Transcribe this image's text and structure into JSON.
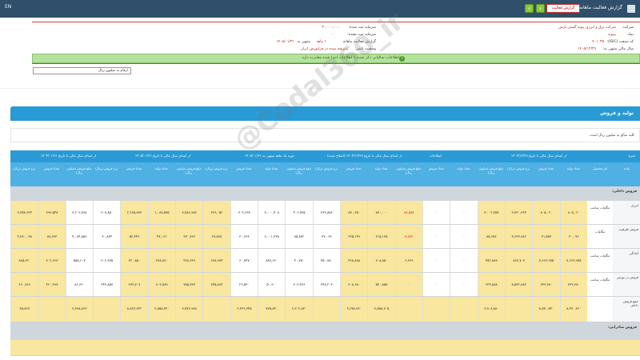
{
  "topbar": {
    "left_text": "EN",
    "title": "گزارش فعالیت ماهانه",
    "report_button": "گزارش فعالیت ماهانه",
    "nav_prev": "‹",
    "nav_next": "›"
  },
  "info": {
    "company_label": "شرکت:",
    "company_value": "شرکت برق و انرژی پیوند گستر پارس",
    "symbol_label": "نماد:",
    "symbol_value": "بپیوند",
    "code_label": "کد صنعت (ISIC):",
    "code_value": "۴۰۱۰۳۵",
    "capital_label": "سرمایه ثبت شده:",
    "capital_value": "۳۰,۰۰۰,۰۰۰",
    "unregistered_label": "سرمایه ثبت نشده:",
    "unregistered_value": "۰",
    "report_label": "گزارش فعالیت ماهانه",
    "period_label": "۱ ماهه",
    "period_end_label": "منتهی به",
    "period_end_value": "۱۴۰۵/۰۱/۳۱",
    "fiscal_label": "سال مالی منتهی به:",
    "fiscal_value": "۱۴۰۵/۱۲/۲۹",
    "status_label": "وضعیت ناشر:",
    "status_value": "پذیرفته شده در فرابورس ایران"
  },
  "notice": "اطلاعات سالیانی ذکر شده با اطلاعات ابتدا شده مغایرت دارد.",
  "select_value": "ارقام به میلیون ریال",
  "section_title": "تولید و فروش",
  "unit_note": "کلیه مبالغ به میلیون ریال است.",
  "watermark": "@Codal360_ir",
  "table": {
    "group_headers": [
      "شرح",
      "از ابتدای سال مالی تا تاریخ ۱۴۰۴/۱۲/۲۹",
      "اصلاحات",
      "از ابتدای سال مالی تا تاریخ ۱۴۰۴/۱۲/۲۹ (اصلاح شده)",
      "دوره یک ماهه منتهی به ۱۴۰۵/۰۱/۳۱",
      "از ابتدای سال مالی تا تاریخ ۱۴۰۵/۰۱/۳۱",
      "از ابتدای سال مالی تا تاریخ ۱۴۰۴/۰۱/۳۱"
    ],
    "columns": [
      "واحد",
      "نام محصول",
      "تعداد تولید",
      "تعداد فروش",
      "نرخ فروش (ریال)",
      "مبلغ فروش (میلیون ریال)",
      "تعداد تولید",
      "تعداد فروش",
      "مبلغ فروش (میلیون ریال)",
      "تعداد تولید",
      "تعداد فروش",
      "نرخ فروش (ریال)",
      "مبلغ فروش (میلیون ریال)",
      "تعداد تولید",
      "تعداد فروش",
      "نرخ فروش (ریال)",
      "مبلغ فروش (میلیون ریال)",
      "تعداد تولید",
      "تعداد فروش",
      "نرخ فروش (ریال)",
      "مبلغ فروش (میلیون ریال)",
      "تعداد فروش",
      "نرخ فروش (ریال)"
    ],
    "group_domestic": "فروش داخلی:",
    "group_export": "فروش صادراتی:",
    "rows": [
      {
        "label": "انرژی",
        "product": "مگاوات ساعت",
        "cells": [
          "۸۰۵,۰۲۰",
          "۸۰۵,۰۲۰",
          "۳,۷۳۰,۳۶۴",
          "۳,۰۰۲,۴۵۷",
          "۰",
          "۰",
          "۸۷,۵۵۷",
          "۸۷۰,۰۰۰",
          "۸۷۰,۳۵۰",
          "۳۶۳,۸۵۶",
          "۴۰۶,۷۳۵",
          "۳,۰۰۰,۴۰۸",
          "۳۰۲,۶۳۷",
          "۳۳۶,۰۵۲",
          "۳,۷۸۶,۹۸۳",
          "۱,۰۸۷,۵۷۵",
          "۲,۶۶۵,۸۳۳",
          "۳۰۷,۸۵۰",
          "۳,۲۰۳,۷۹۸",
          "۳۹۳,۵۴۸",
          "۳,۳۵۷,۶۳۴",
          "۳۴۵,۷۰۳",
          "۳,۵۰۳,۶۷۳"
        ],
        "red": [
          6
        ]
      },
      {
        "label": "فروش ظرفیت",
        "product": "مگاوات",
        "cells": [
          "۳۰,۰۷۶",
          "۳۱,۵۸۴",
          "۳,۶۳۳,۹۸۶",
          "۸۵,۶۵۶",
          "۰",
          "۰",
          "۵,۸۷۲",
          "۳۱۵,۱۳۵",
          "۳۲۵,۱۴۹",
          "۳۷,۰۶۳",
          "۸۵,۸۳۲",
          "۶,۰۰۱,۳۳۸",
          "۳۰,۶۳۶",
          "۳۷,۸۳۸",
          "۳۷۰,۷۶۶",
          "۴۷,۰۳۱",
          "۵۳,۴۴۹",
          "۳۰,۸۷۴",
          "۴,۰۸۴,۸۵۹",
          "۸۷,۶۳۳",
          "۴,۳۸۰,۰۳۸",
          "۳۲۹,۸۰۶",
          "۳۵,۰۳۰"
        ],
        "red": [
          6
        ]
      },
      {
        "label": "آمادگی",
        "product": "مگاوات ساعت",
        "cells": [
          "۷,۶۶۳,۹۷۵",
          "۷,۶۶۳,۹۷۵",
          "۸۶۳,۷۰۳",
          "۴۵۲,۸۸۳",
          "۰",
          "۰",
          "۶,۳۶۹",
          "۳۰۸,۸۵۰",
          "۴۶۸,۸۸۸",
          "۴۵۰,۷۸۰",
          "۴۰,۷۵۰",
          "۸۸۷,۶۶۰",
          "۶۰,۷۴۷",
          "۶۳۸,۹۹۴",
          "۴۶۸,۶۳۹",
          "۳۷۸,۸۳۰",
          "۳۲۰,۸۵۰",
          "۳۰۲,۳۷۵",
          "۵۵۸,۶۰۷",
          "۳۰۲,۶۶۳",
          "۹۸۵,۳۲۰",
          "۷۸۳,۹۵۰",
          "۹۲۵,۰۴۰"
        ],
        "red": []
      },
      {
        "label": "فروش در بورس",
        "product": "مگاوات ساعت",
        "cells": [
          "۳۳۳,۳۸۰",
          "۳۳۳,۳۸۰",
          "۸,۵۷۲,۸۸۳",
          "۶۲۴,۸۸۸",
          "۰",
          "۰",
          "۰",
          "۵۳۰,۸۵۸",
          "۳۰۸,۶۸۰",
          "۳۴۸,۲۰۳",
          "۳۰۳,۳۶۶",
          "۵۰,۳۰۰",
          "۲۶,۵۳۰",
          "۷۳۵,۸۹۳",
          "۷۸۵,۷۳۳",
          "۸۰۳,۷۸۹",
          "۶۳۳,۷۰۷",
          "۳۴۳,۸۵۷",
          "۸۶,۶۳۰",
          "۴۶۰,۳۹۷",
          "۶۶۰,۸۶۹",
          "۵۸۰,۸۸۲",
          "۵۳۵,۰۷۶"
        ],
        "red": []
      },
      {
        "label": "جمع فروش داخلی",
        "product": "",
        "cells": [
          "۸,۴۷۰,۳۶۰",
          "۸,۵۷۰,۸۴۰",
          "",
          "۳,۸۰۸,۸۸۰",
          "",
          "",
          "",
          "۳,۸۵۸,۳۰۵",
          "۶,۶۷۸,۹۳۰",
          "",
          "۶,۳۰۲,۸۳۰",
          "۷۳۵,۸۴۰",
          "۶,۳۳۶,۳۴۵",
          "",
          "۳,۷۷۶,۹۸۸",
          "۳,۸۵۸,۷۲۰",
          "۸,۸۶۳,۷۲۲",
          "",
          "۳,۷۹۸,۸۶۳",
          "",
          "۳۵,۸۶۷",
          "۳,۶۸۶,۸۷۷",
          "۳۵,۳۰۸,۰۳۳"
        ],
        "red": []
      }
    ]
  }
}
